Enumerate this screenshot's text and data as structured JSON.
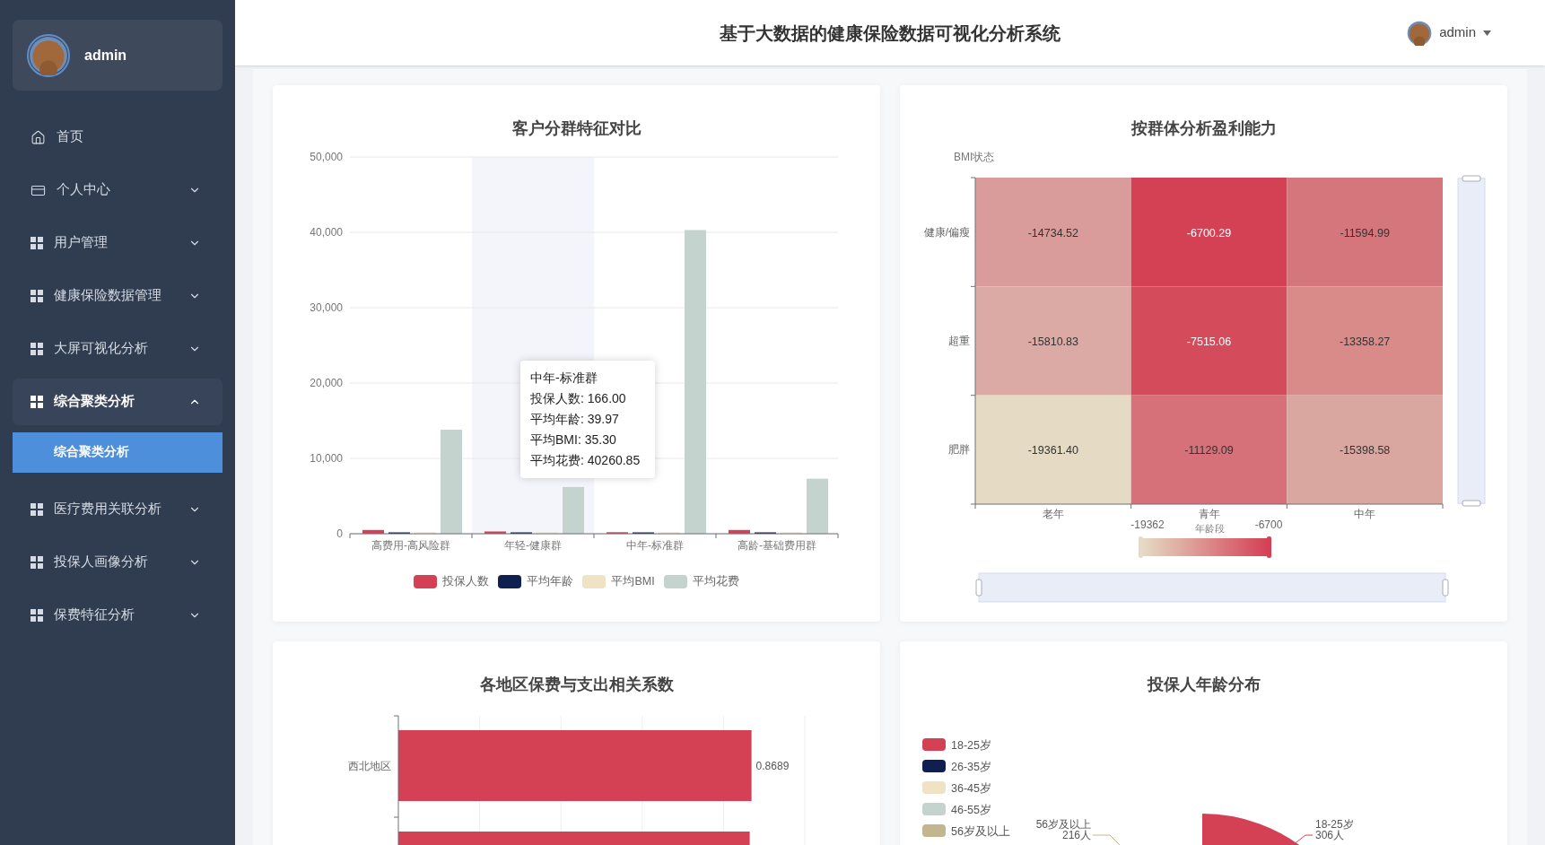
{
  "sidebar": {
    "user": {
      "name": "admin"
    },
    "items": [
      {
        "label": "首页",
        "kind": "home",
        "expanded": false
      },
      {
        "label": "个人中心",
        "kind": "account",
        "expanded": false
      },
      {
        "label": "用户管理",
        "kind": "module",
        "expanded": false
      },
      {
        "label": "健康保险数据管理",
        "kind": "module",
        "expanded": false
      },
      {
        "label": "大屏可视化分析",
        "kind": "module",
        "expanded": false
      },
      {
        "label": "综合聚类分析",
        "kind": "module",
        "expanded": true,
        "children": [
          {
            "label": "综合聚类分析",
            "selected": true
          }
        ]
      },
      {
        "label": "医疗费用关联分析",
        "kind": "module",
        "expanded": false
      },
      {
        "label": "投保人画像分析",
        "kind": "module",
        "expanded": false
      },
      {
        "label": "保费特征分析",
        "kind": "module",
        "expanded": false
      }
    ]
  },
  "header": {
    "title": "基于大数据的健康保险数据可视化分析系统",
    "user": "admin"
  },
  "cluster_chart": {
    "title": "客户分群特征对比",
    "chart_data": {
      "type": "bar",
      "categories": [
        "高费用-高风险群",
        "年轻-健康群",
        "中年-标准群",
        "高龄-基础费用群"
      ],
      "ylim": [
        0,
        50000
      ],
      "grid": true,
      "yticks": [
        {
          "value": 0,
          "label": "0"
        },
        {
          "value": 10000,
          "label": "10,000"
        },
        {
          "value": 20000,
          "label": "20,000"
        },
        {
          "value": 30000,
          "label": "30,000"
        },
        {
          "value": 40000,
          "label": "40,000"
        },
        {
          "value": 50000,
          "label": "50,000"
        }
      ],
      "series": [
        {
          "name": "投保人数",
          "color": "#d44155",
          "values": [
            500,
            300,
            200,
            500
          ]
        },
        {
          "name": "平均年龄",
          "color": "#0f1f4f",
          "values": [
            0,
            0,
            0,
            0
          ]
        },
        {
          "name": "平均BMI",
          "color": "#efe3c3",
          "values": [
            0,
            0,
            0,
            0
          ]
        },
        {
          "name": "平均花费",
          "color": "#c4d3cd",
          "values": [
            13800,
            6200,
            40300,
            7300
          ]
        }
      ]
    },
    "pointer_shadow": [
      {
        "selected": false
      },
      {
        "selected": true
      },
      {
        "selected": false
      },
      {
        "selected": false
      }
    ],
    "tooltip": {
      "title": "中年-标准群",
      "lines": [
        "投保人数: 166.00",
        "平均年龄: 39.97",
        "平均BMI: 35.30",
        "平均花费: 40260.85"
      ]
    }
  },
  "profit_heatmap": {
    "title": "按群体分析盈利能力",
    "y_name": "BMI状态",
    "x_name": "年龄段",
    "x": [
      "老年",
      "青年",
      "中年"
    ],
    "y": [
      "健康/偏瘦",
      "超重",
      "肥胖"
    ],
    "rows": [
      [
        {
          "value": "-14734.52",
          "color": "#d99c9a"
        },
        {
          "value": "-6700.29",
          "color": "#d44155"
        },
        {
          "value": "-11594.99",
          "color": "#d5767d"
        }
      ],
      [
        {
          "value": "-15810.83",
          "color": "#dbaaa5"
        },
        {
          "value": "-7515.06",
          "color": "#d44b5c"
        },
        {
          "value": "-13358.27",
          "color": "#d88b89"
        }
      ],
      [
        {
          "value": "-19361.40",
          "color": "#e5dac4"
        },
        {
          "value": "-11129.09",
          "color": "#d6717a"
        },
        {
          "value": "-15398.58",
          "color": "#d9a6a0"
        }
      ]
    ],
    "color_scale": {
      "min": "-19362",
      "max": "-6700"
    }
  },
  "region_chart": {
    "title": "各地区保费与支出相关系数",
    "bars": [
      {
        "region": "西北地区",
        "value": "0.8689"
      }
    ]
  },
  "age_chart": {
    "title": "投保人年龄分布",
    "legend": [
      {
        "label": "18-25岁",
        "color": "#d44155"
      },
      {
        "label": "26-35岁",
        "color": "#0f1f4f"
      },
      {
        "label": "36-45岁",
        "color": "#efe3c3"
      },
      {
        "label": "46-55岁",
        "color": "#c4d3cd"
      },
      {
        "label": "56岁及以上",
        "color": "#c2b68e"
      }
    ],
    "slice_labels": [
      {
        "name": "56岁及以上",
        "count": "216人"
      },
      {
        "name": "18-25岁",
        "count": "306人"
      }
    ]
  }
}
